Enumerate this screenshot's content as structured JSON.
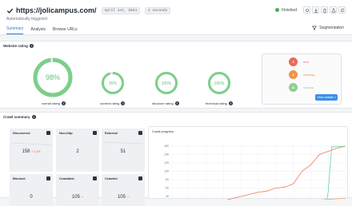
{
  "header": {
    "site_url": "https://jolicampus.com/",
    "date_chip": "April 1st, 2024",
    "duration_chip": "2 seconds",
    "sub_label": "Automatically triggered",
    "status": "Finished",
    "status_color": "#4caf50"
  },
  "tabs": [
    {
      "label": "Summary",
      "active": true
    },
    {
      "label": "Analysis",
      "active": false
    },
    {
      "label": "Browse URLs",
      "active": false
    }
  ],
  "segmentation_label": "Segmentation",
  "rating": {
    "title": "Website rating",
    "gauges": [
      {
        "value": "98%",
        "label": "overall rating",
        "fraction": 0.98
      },
      {
        "value": "95%",
        "label": "content rating",
        "fraction": 0.95
      },
      {
        "value": "100%",
        "label": "structure rating",
        "fraction": 1.0
      },
      {
        "value": "100%",
        "label": "technical rating",
        "fraction": 1.0
      }
    ],
    "gauge_color": "#7ccf8a",
    "issues": [
      {
        "count": "3",
        "label": "error",
        "color": "#ea6a5a"
      },
      {
        "count": "2",
        "label": "warnings",
        "color": "#f0944a"
      },
      {
        "count": "11",
        "label": "success",
        "color": "#8fce8c"
      }
    ],
    "view_details": "View details >"
  },
  "crawl": {
    "title": "Crawl summary",
    "metrics": [
      {
        "title": "Discovered",
        "value": "158",
        "delta": "+ 1.2%"
      },
      {
        "title": "Non-http",
        "value": "2",
        "delta": ""
      },
      {
        "title": "External",
        "value": "51",
        "delta": ""
      },
      {
        "title": "Blocked",
        "value": "0",
        "delta": ""
      },
      {
        "title": "Crawlable",
        "value": "105",
        "delta": "+"
      },
      {
        "title": "Crawled",
        "value": "105",
        "delta": "+"
      }
    ],
    "progress_title": "Crawl progress"
  },
  "chart_data": {
    "type": "line",
    "title": "Crawl progress",
    "y_ticks": [
      "160",
      "140",
      "120",
      "100",
      "80",
      "60",
      "40",
      "20",
      "0"
    ],
    "ylim": [
      0,
      160
    ],
    "series": [
      {
        "color": "#f07a5a",
        "x": [
          0,
          10,
          20,
          30,
          40,
          50,
          55,
          60,
          65,
          70,
          75,
          80,
          85,
          95,
          100
        ],
        "y": [
          0,
          8,
          20,
          30,
          40,
          50,
          53,
          60,
          62,
          70,
          100,
          115,
          140,
          155,
          160
        ]
      },
      {
        "color": "#f0a070",
        "x": [
          0,
          10,
          20,
          30,
          40,
          50,
          60,
          70,
          80,
          90,
          100
        ],
        "y": [
          0,
          3,
          6,
          10,
          14,
          18,
          22,
          26,
          30,
          33,
          36
        ]
      },
      {
        "color": "#6dd3a0",
        "x": [
          0,
          80,
          88,
          90,
          92,
          100
        ],
        "y": [
          0,
          0,
          2,
          50,
          158,
          160
        ]
      },
      {
        "color": "#6aaee8",
        "x": [
          0,
          100
        ],
        "y": [
          0,
          0
        ]
      }
    ]
  }
}
